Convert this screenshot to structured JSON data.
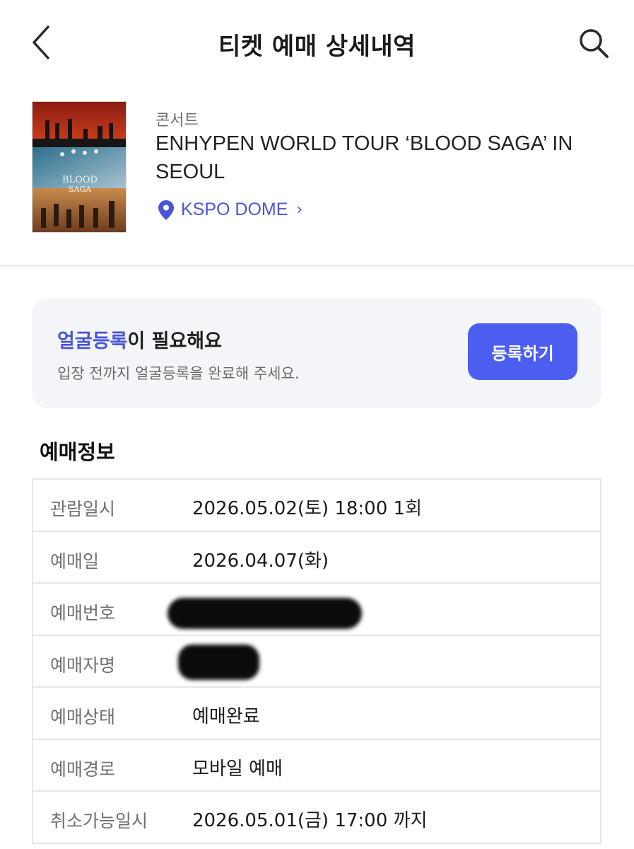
{
  "header": {
    "title": "티켓 예매 상세내역",
    "back_icon": "chevron-left-icon",
    "search_icon": "search-icon"
  },
  "event": {
    "category": "콘서트",
    "title": "ENHYPEN WORLD TOUR ‘BLOOD SAGA’ IN SEOUL",
    "venue": "KSPO DOME",
    "venue_icon": "location-pin-icon",
    "poster_text_line1": "BLOOD",
    "poster_text_line2": "SAGA"
  },
  "face_registration": {
    "title_accent": "얼굴등록",
    "title_rest": "이 필요해요",
    "subtitle": "입장 전까지 얼굴등록을 완료해 주세요.",
    "button_label": "등록하기"
  },
  "booking_info": {
    "section_title": "예매정보",
    "rows": [
      {
        "label": "관람일시",
        "value": "2026.05.02(토) 18:00 1회"
      },
      {
        "label": "예매일",
        "value": "2026.04.07(화)"
      },
      {
        "label": "예매번호",
        "value": ""
      },
      {
        "label": "예매자명",
        "value": ""
      },
      {
        "label": "예매상태",
        "value": "예매완료"
      },
      {
        "label": "예매경로",
        "value": "모바일 예매"
      },
      {
        "label": "취소가능일시",
        "value": "2026.05.01(금) 17:00 까지"
      }
    ]
  },
  "colors": {
    "accent": "#4a55d6",
    "button": "#4b5ef0",
    "card_bg": "#f4f5f9"
  }
}
